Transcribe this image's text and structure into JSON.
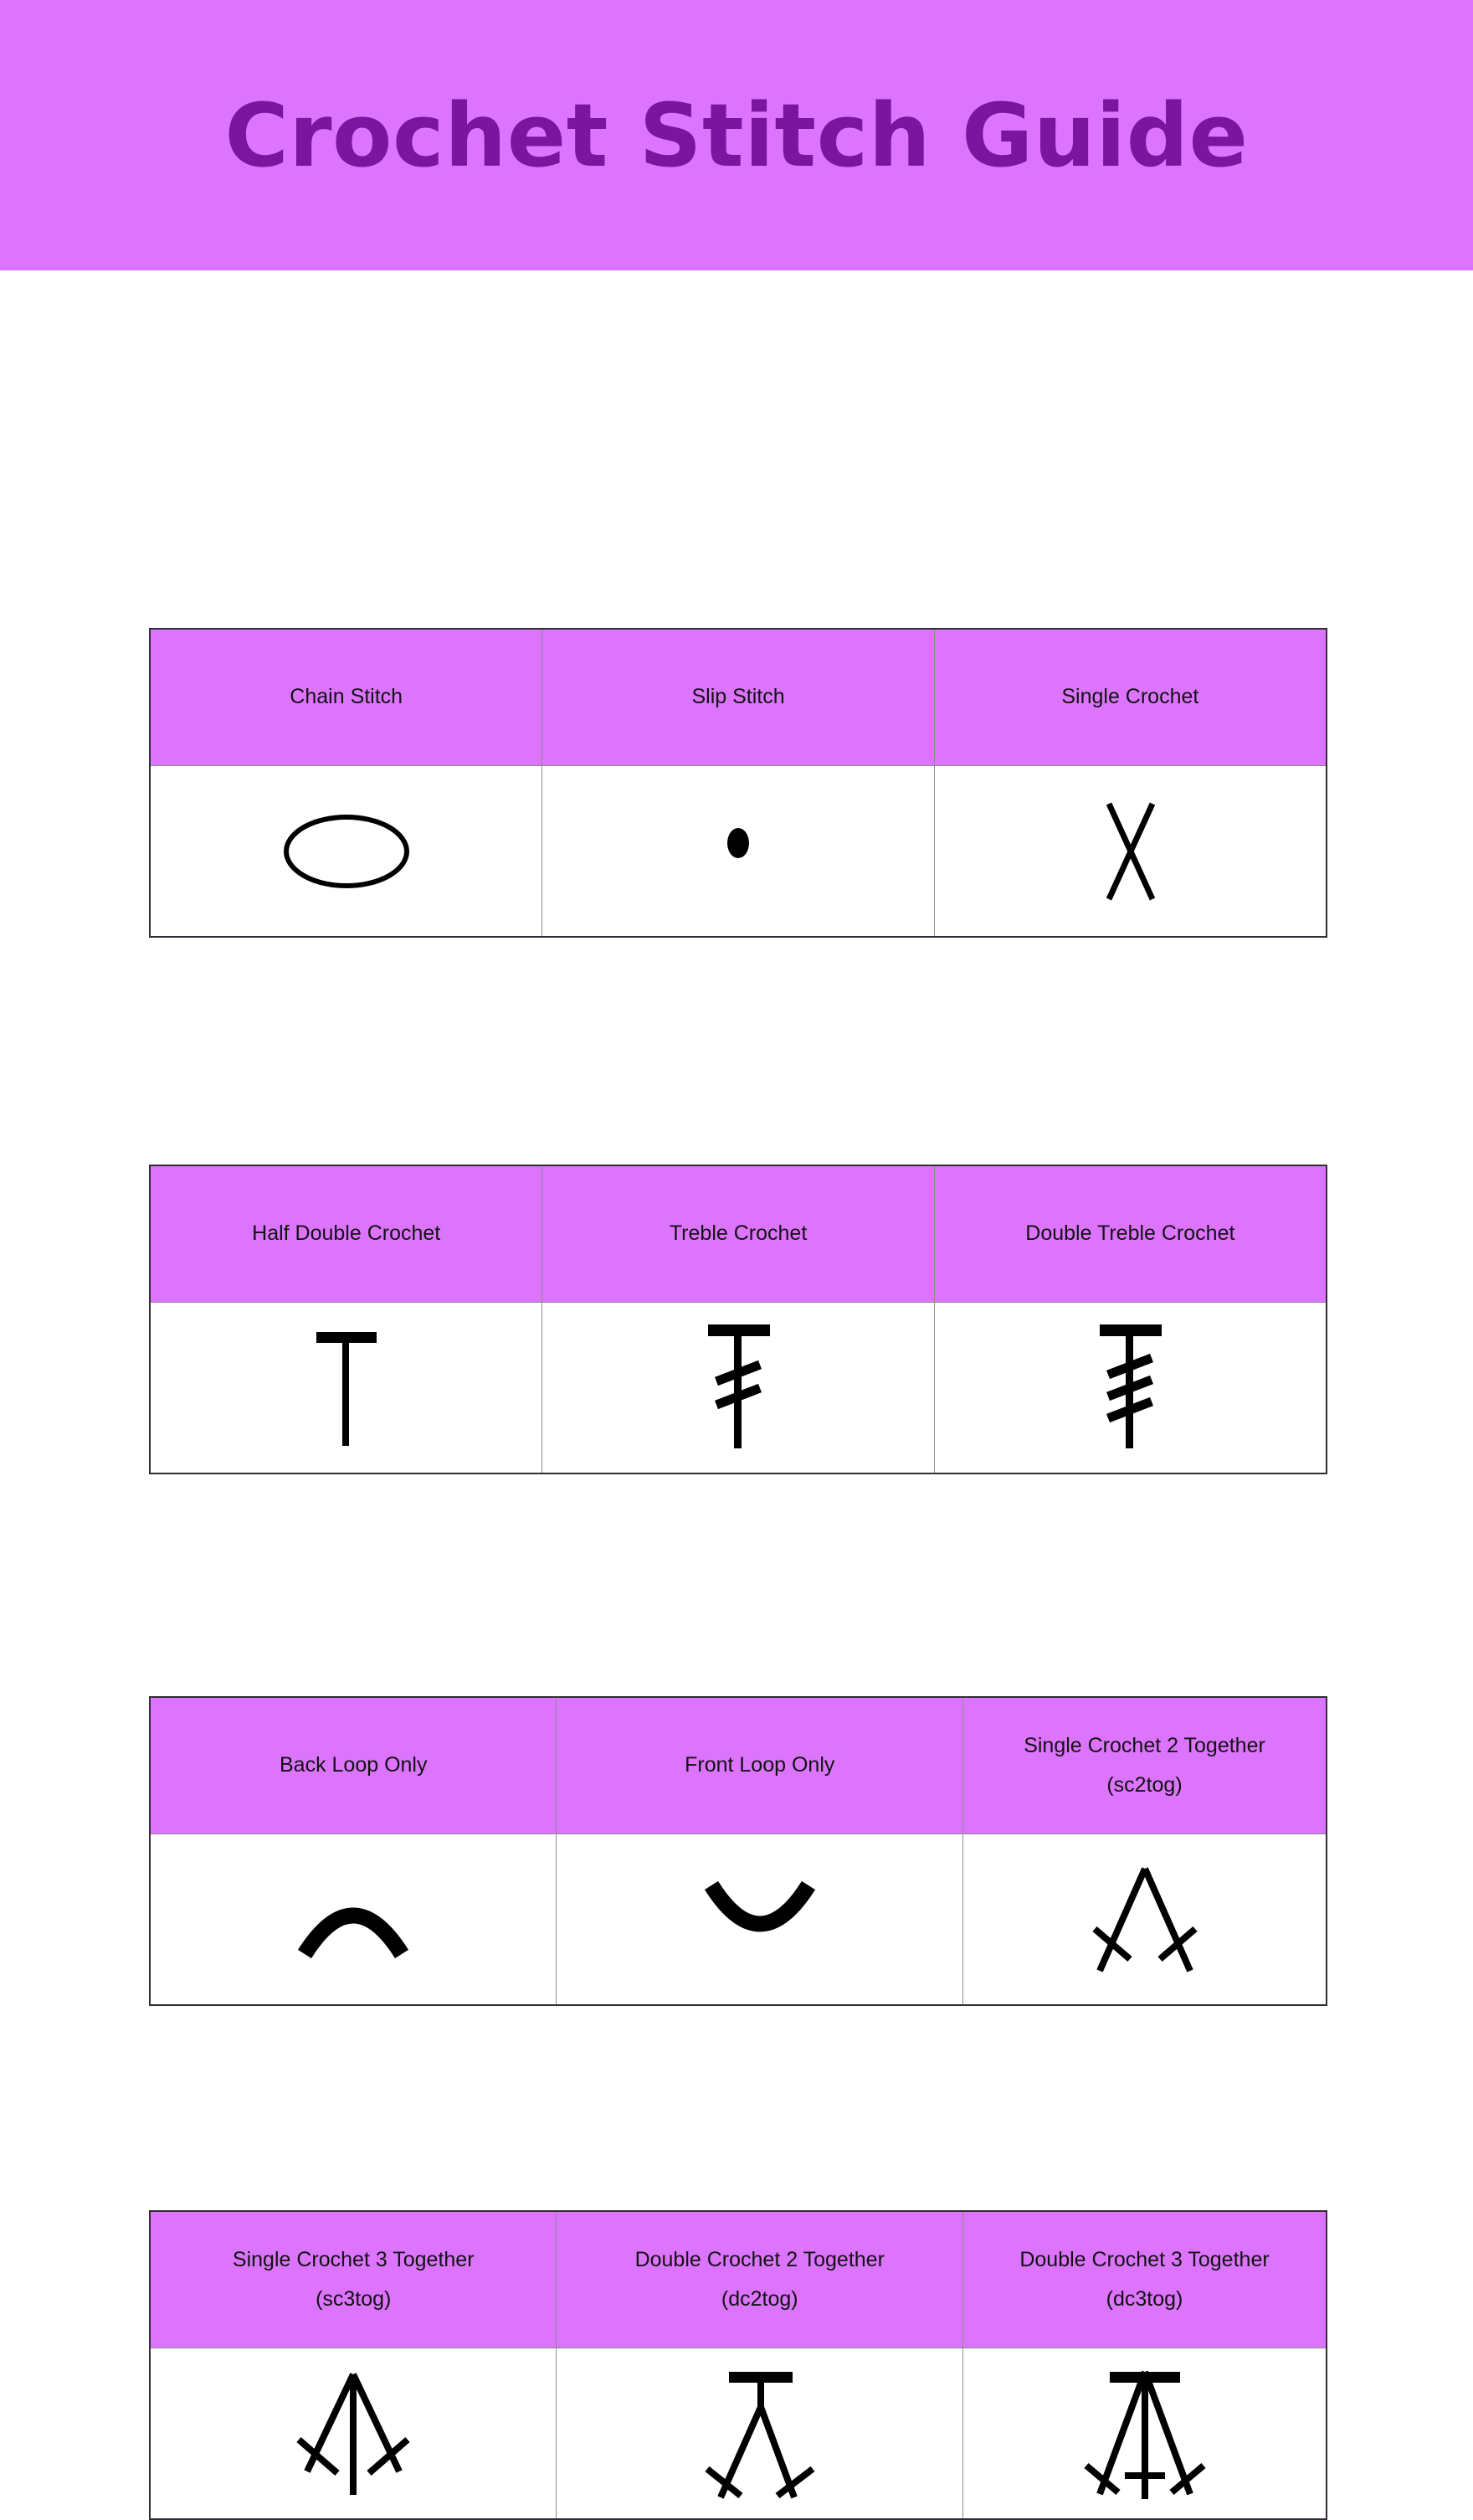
{
  "header": {
    "title": "Crochet Stitch Guide",
    "banner_color": "#dd74fd",
    "title_color": "#7b159e"
  },
  "colors": {
    "header_cell_bg": "#dd74fd",
    "body_cell_bg": "#ffffff",
    "outer_border": "#332b35",
    "inner_border": "#8c8c8c",
    "symbol_color": "#000000"
  },
  "tables": [
    {
      "id": "table-1",
      "columns": [
        {
          "label": "Chain Stitch",
          "sub": "",
          "symbol": "chain-stitch-symbol"
        },
        {
          "label": "Slip Stitch",
          "sub": "",
          "symbol": "slip-stitch-symbol"
        },
        {
          "label": "Single Crochet",
          "sub": "",
          "symbol": "single-crochet-symbol"
        }
      ]
    },
    {
      "id": "table-2",
      "columns": [
        {
          "label": "Half Double Crochet",
          "sub": "",
          "symbol": "half-double-crochet-symbol"
        },
        {
          "label": "Treble Crochet",
          "sub": "",
          "symbol": "treble-crochet-symbol"
        },
        {
          "label": "Double Treble Crochet",
          "sub": "",
          "symbol": "double-treble-crochet-symbol"
        }
      ]
    },
    {
      "id": "table-3",
      "columns": [
        {
          "label": "Back Loop Only",
          "sub": "",
          "symbol": "back-loop-only-symbol"
        },
        {
          "label": "Front Loop Only",
          "sub": "",
          "symbol": "front-loop-only-symbol"
        },
        {
          "label": "Single Crochet 2 Together",
          "sub": "(sc2tog)",
          "symbol": "sc2tog-symbol"
        }
      ]
    },
    {
      "id": "table-4",
      "columns": [
        {
          "label": "Single Crochet 3 Together",
          "sub": "(sc3tog)",
          "symbol": "sc3tog-symbol"
        },
        {
          "label": "Double Crochet 2 Together",
          "sub": "(dc2tog)",
          "symbol": "dc2tog-symbol"
        },
        {
          "label": "Double Crochet 3 Together",
          "sub": "(dc3tog)",
          "symbol": "dc3tog-symbol"
        }
      ]
    }
  ]
}
